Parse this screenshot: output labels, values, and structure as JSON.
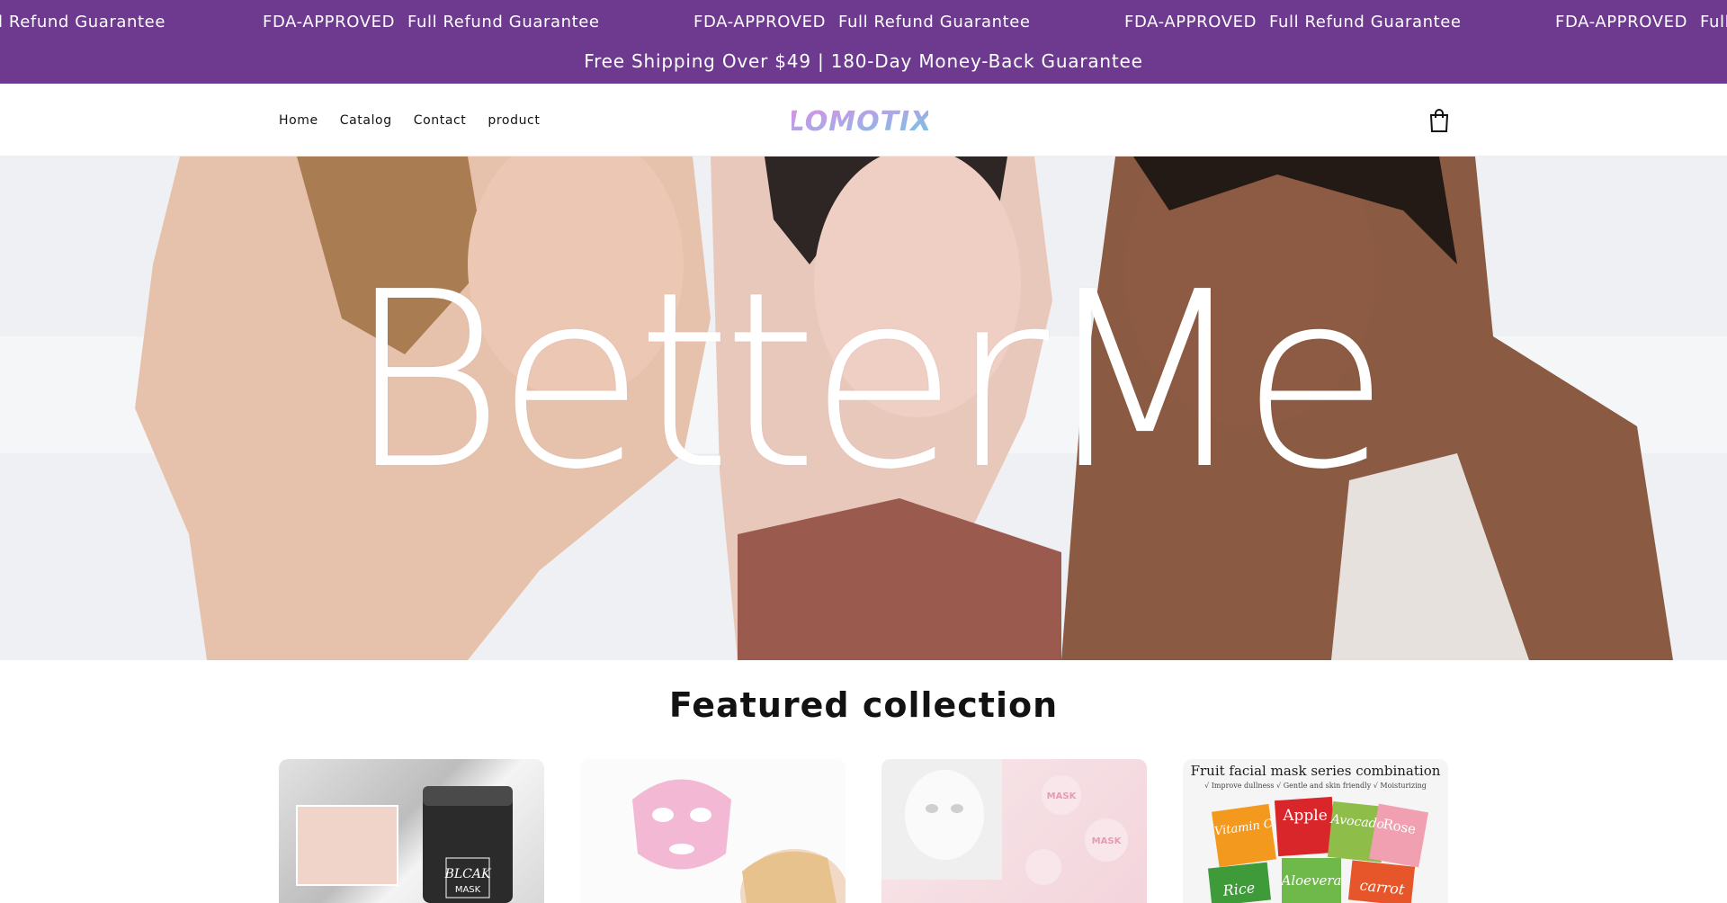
{
  "announcement": {
    "marquee": [
      "l Refund Guarantee",
      "FDA-APPROVED",
      "Full Refund Guarantee",
      "FDA-APPROVED",
      "Full Refund Guarantee",
      "FDA-APPROVED",
      "Full Refund Guarantee",
      "FDA-APPROVED",
      "Full"
    ],
    "shipping": "Free Shipping Over $49 | 180-Day Money-Back Guarantee"
  },
  "nav": {
    "items": [
      "Home",
      "Catalog",
      "Contact",
      "product"
    ]
  },
  "brand": {
    "logo_text": "LOMOTIX"
  },
  "hero": {
    "title": "BetterMe"
  },
  "featured": {
    "heading": "Featured collection",
    "cards": [
      {
        "image_text": [
          "BLCAK",
          "MASK"
        ]
      },
      {
        "image_text": []
      },
      {
        "image_text": [
          "MASK",
          "MASK"
        ]
      },
      {
        "image_text": [
          "Fruit facial mask series combination",
          "√ Improve dullness   √ Gentle and skin friendly   √ Moisturizing",
          "Vitamin C",
          "Apple",
          "Avocado",
          "Rose",
          "Rice",
          "Aloevera",
          "carrot"
        ]
      }
    ]
  },
  "colors": {
    "announcement_bg": "#6d3a8f",
    "text": "#121212",
    "logo_gradient": [
      "#e08ce6",
      "#6fc7e6"
    ]
  },
  "icons": {
    "cart": "shopping-bag-icon"
  }
}
